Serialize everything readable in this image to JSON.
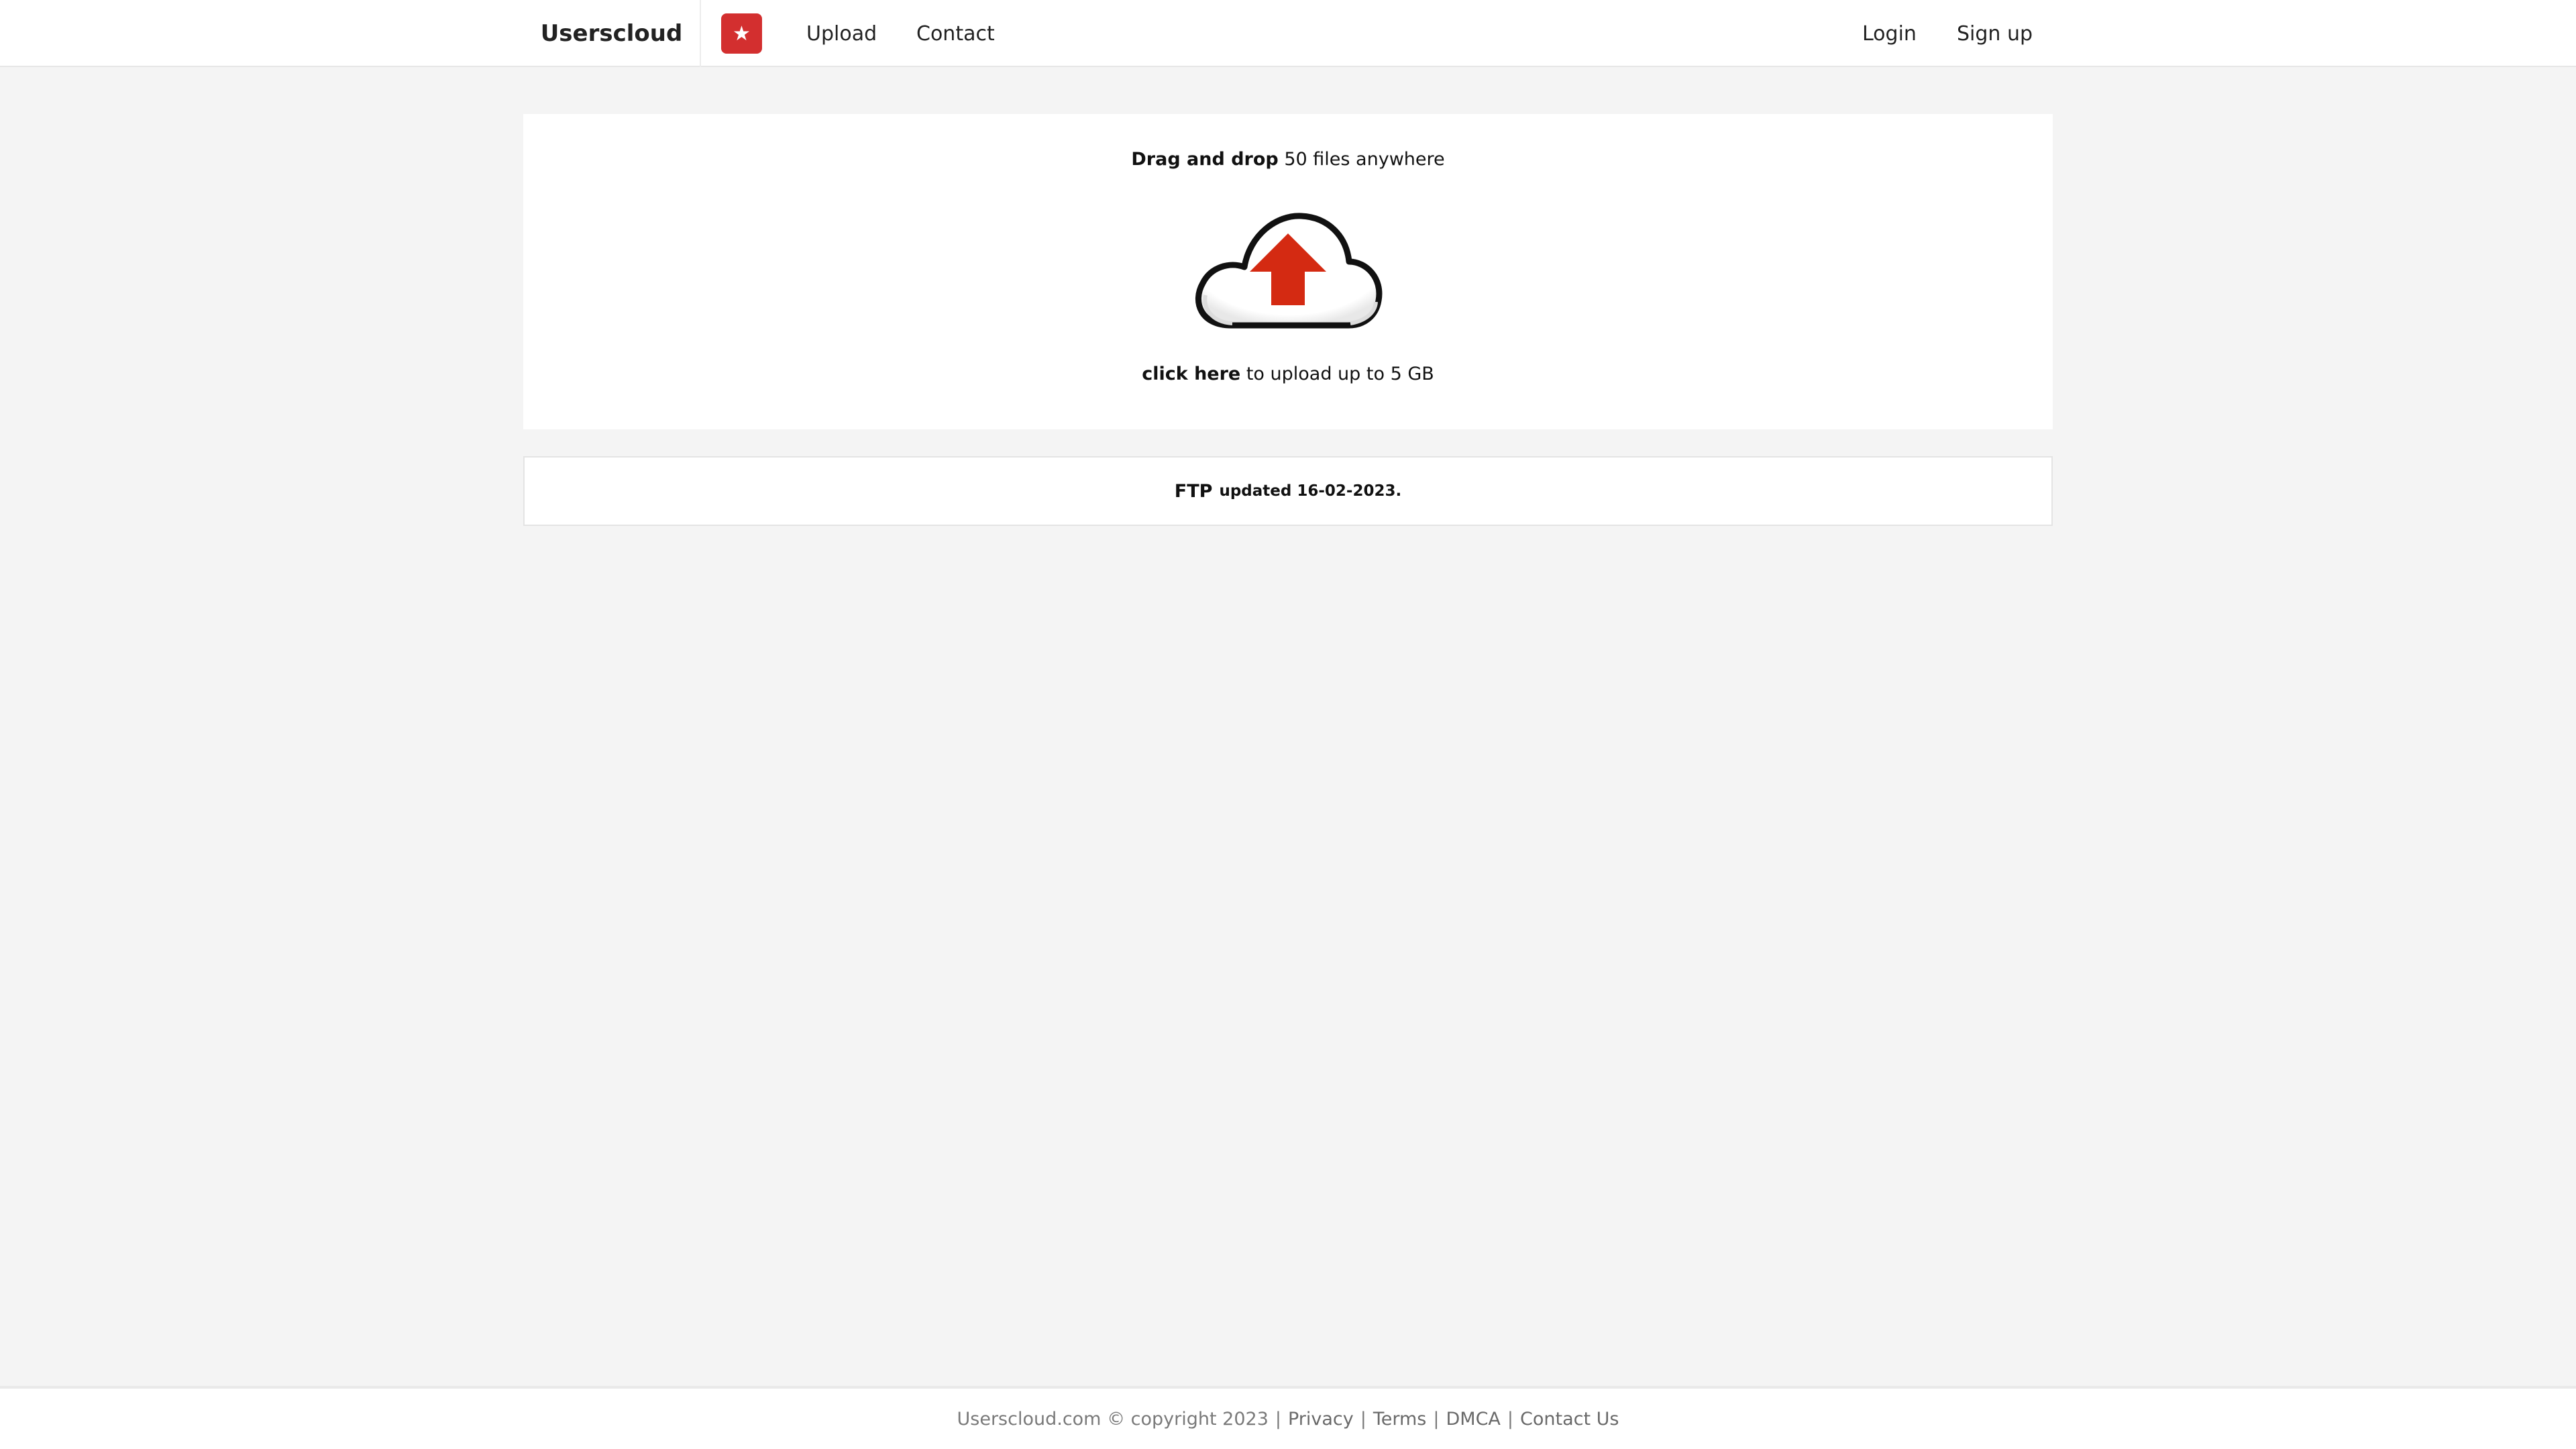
{
  "navbar": {
    "brand": "Userscloud",
    "badge_icon": "star-icon",
    "badge_color": "#d32f2f",
    "links": {
      "upload": "Upload",
      "contact": "Contact",
      "login": "Login",
      "signup": "Sign up"
    }
  },
  "upload": {
    "drag_bold": "Drag and drop",
    "drag_rest": "50 files anywhere",
    "icon": "cloud-upload-icon",
    "arrow_color": "#d42a12",
    "click_bold": "click here",
    "click_rest": "to upload up to 5 GB"
  },
  "ftp": {
    "title": "FTP",
    "note": "updated 16-02-2023."
  },
  "footer": {
    "copyright": "Userscloud.com © copyright 2023",
    "separator": "|",
    "links": [
      "Privacy",
      "Terms",
      "DMCA",
      "Contact Us"
    ]
  }
}
